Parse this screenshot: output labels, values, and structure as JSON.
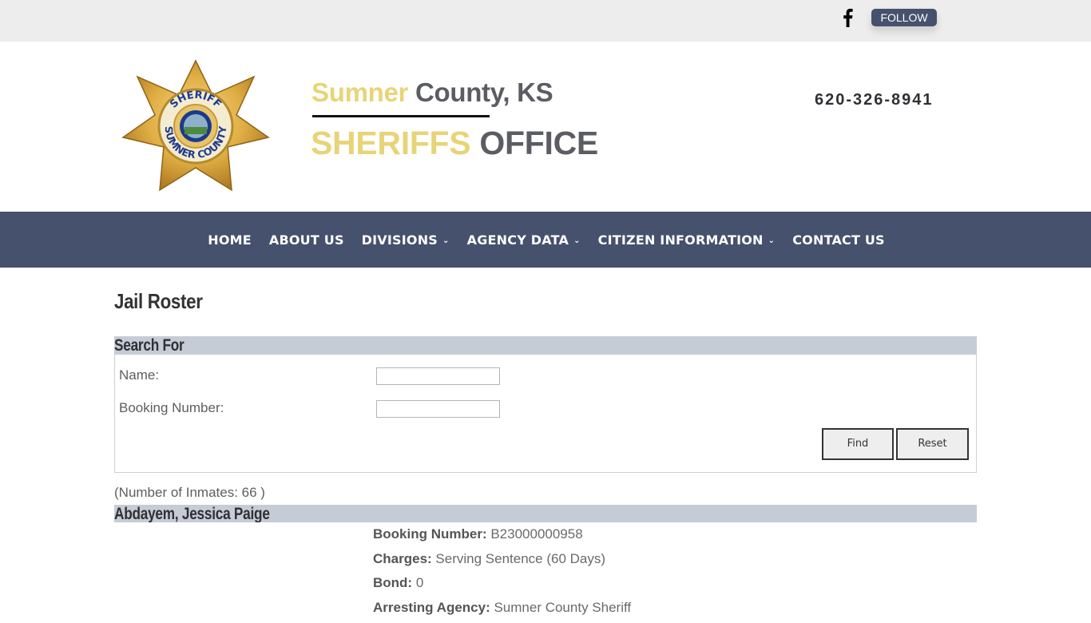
{
  "topbar": {
    "social_icon": "facebook-icon",
    "follow_label": "FOLLOW"
  },
  "header": {
    "logo": "sheriff-badge-logo",
    "title_line1_accent": "Sumner",
    "title_line1_main": " County, KS",
    "title_line2_accent": "SHERIFFS",
    "title_line2_main": " OFFICE",
    "phone": "620-326-8941"
  },
  "colors": {
    "nav_bg": "#45516d",
    "accent_gold": "#e8d478",
    "title_gray": "#5b5d63",
    "section_bar": "#c6ccd6"
  },
  "nav": {
    "items": [
      {
        "label": "HOME",
        "dropdown": false
      },
      {
        "label": "ABOUT US",
        "dropdown": false
      },
      {
        "label": "DIVISIONS",
        "dropdown": true
      },
      {
        "label": "AGENCY DATA",
        "dropdown": true
      },
      {
        "label": "CITIZEN INFORMATION",
        "dropdown": true
      },
      {
        "label": "CONTACT US",
        "dropdown": false
      }
    ]
  },
  "main": {
    "page_title": "Jail Roster",
    "search": {
      "heading": "Search For",
      "name_label": "Name:",
      "name_value": "",
      "booking_label": "Booking Number:",
      "booking_value": "",
      "find_label": "Find",
      "reset_label": "Reset"
    },
    "inmate_count_text": "(Number of Inmates: 66 )",
    "inmates": [
      {
        "name": "Abdayem, Jessica Paige",
        "fields": [
          {
            "label": "Booking Number:",
            "value": " B23000000958"
          },
          {
            "label": "Charges:",
            "value": " Serving Sentence (60 Days)"
          },
          {
            "label": "Bond:",
            "value": " 0"
          },
          {
            "label": "Arresting Agency:",
            "value": " Sumner County Sheriff"
          }
        ]
      }
    ]
  }
}
